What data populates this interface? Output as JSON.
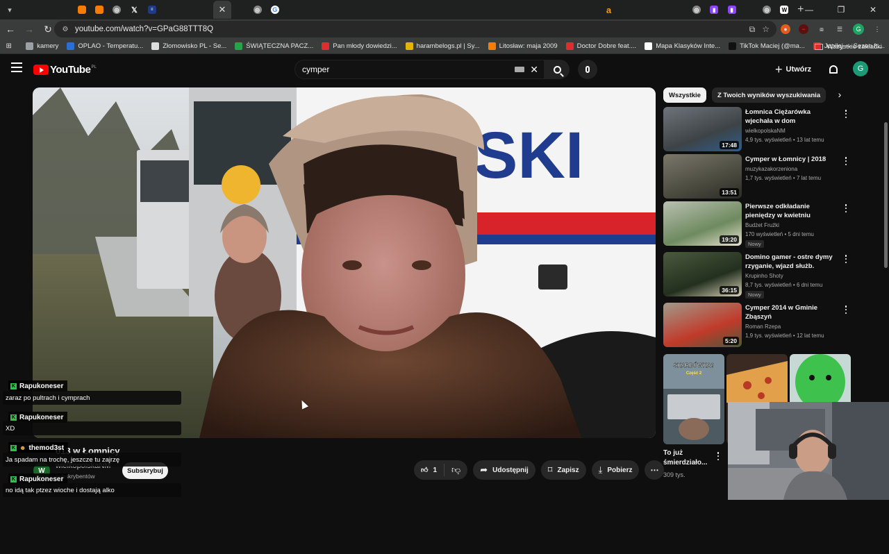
{
  "browser": {
    "tab_strip": {
      "tabs": [
        "yt",
        "yt",
        "yt",
        "blog",
        "blog",
        "grey",
        "x",
        "navy",
        "yt",
        "yt",
        "yt",
        "active",
        "yt",
        "grey",
        "g",
        "yt",
        "yt",
        "yt",
        "yt",
        "yt",
        "yt",
        "yt",
        "yt",
        "yt",
        "yt",
        "yt",
        "yt",
        "yt",
        "yt",
        "yt",
        "yt",
        "yt",
        "yt",
        "amz",
        "yt",
        "yt",
        "yt",
        "yt",
        "grey",
        "tw",
        "tw",
        "yt",
        "grey",
        "w"
      ],
      "close_glyph": "✕",
      "new_tab_glyph": "+"
    },
    "url": "youtube.com/watch?v=GPaG88TTT8Q",
    "profile_initial": "G",
    "bookmarks": [
      {
        "label": "kamery",
        "color": "#9aa0a6"
      },
      {
        "label": "OPLAO - Temperatu...",
        "color": "#2a6fd6"
      },
      {
        "label": "Złomowisko PL - Se...",
        "color": "#dddddd"
      },
      {
        "label": "ŚWIĄTECZNA PACZ...",
        "color": "#21a548"
      },
      {
        "label": "Pan młody dowiedzi...",
        "color": "#e02c2c"
      },
      {
        "label": "harambelogs.pl | Sy...",
        "color": "#e3b500"
      },
      {
        "label": "Litosław: maja 2009",
        "color": "#f57d00"
      },
      {
        "label": "Doctor Dobre feat....",
        "color": "#e02c2c"
      },
      {
        "label": "Mapa Klasyków Inte...",
        "color": "#ffffff"
      },
      {
        "label": "TikTok Maciej (@ma...",
        "color": "#111111"
      },
      {
        "label": "Jupiłej — Sezon ft....",
        "color": "#e02c2c"
      }
    ],
    "all_bookmarks": "Wszystkie zakładki"
  },
  "youtube": {
    "logo_text": "YouTube",
    "logo_region": "PL",
    "search_query": "cymper",
    "create_label": "Utwórz",
    "avatar_initial": "G",
    "video": {
      "title": "013 w Łomnicy",
      "channel_name": "wielkopolskaNM",
      "channel_initial": "W",
      "subscribers": "subskrybentów",
      "subscribe_label": "Subskrybuj",
      "likes": "1",
      "share_label": "Udostępnij",
      "save_label": "Zapisz",
      "download_label": "Pobierz",
      "van_text": "SKI"
    },
    "chips": [
      "Wszystkie",
      "Z Twoich wyników wyszukiwania"
    ],
    "recommendations": [
      {
        "title": "Łomnica  Ciężarówka wjechała w dom",
        "channel": "wielkopolskaNM",
        "meta": "4,9 tys. wyświetleń • 13 lat temu",
        "duration": "17:48",
        "badge": ""
      },
      {
        "title": "Cymper w Łomnicy | 2018",
        "channel": "muzykazakorzeniona",
        "meta": "1,7 tys. wyświetleń • 7 lat temu",
        "duration": "13:51",
        "badge": ""
      },
      {
        "title": "Pierwsze odkładanie pieniędzy w kwietniu",
        "channel": "Budżet Fruźki",
        "meta": "170 wyświetleń • 5 dni temu",
        "duration": "19:20",
        "badge": "Nowy"
      },
      {
        "title": "Domino gamer - ostre dymy rzyganie, wjazd służb.",
        "channel": "Krupinho Shoty",
        "meta": "8,7 tys. wyświetleń • 6 dni temu",
        "duration": "36:15",
        "badge": "Nowy"
      },
      {
        "title": "Cymper 2014 w Gminie Zbąszyń",
        "channel": "Roman Rzepa",
        "meta": "1,9 tys. wyświetleń • 12 lat temu",
        "duration": "5:20",
        "badge": ""
      }
    ],
    "shorts": [
      {
        "title": "To już śmierdziało...",
        "views": "309 tys.",
        "overlay": "SKARBÓWKA?",
        "overlay2": "Część 2"
      }
    ]
  },
  "chat": [
    {
      "user": "Rapukoneser",
      "text": "zaraz po pultrach i cymprach"
    },
    {
      "user": "Rapukoneser",
      "text": "XD"
    },
    {
      "user": "themod3st",
      "text": "Ja spadam na trochę, jeszcze tu zajrzę"
    },
    {
      "user": "Rapukoneser",
      "text": "no idą tak ptzez wioche i dostają alko"
    }
  ]
}
